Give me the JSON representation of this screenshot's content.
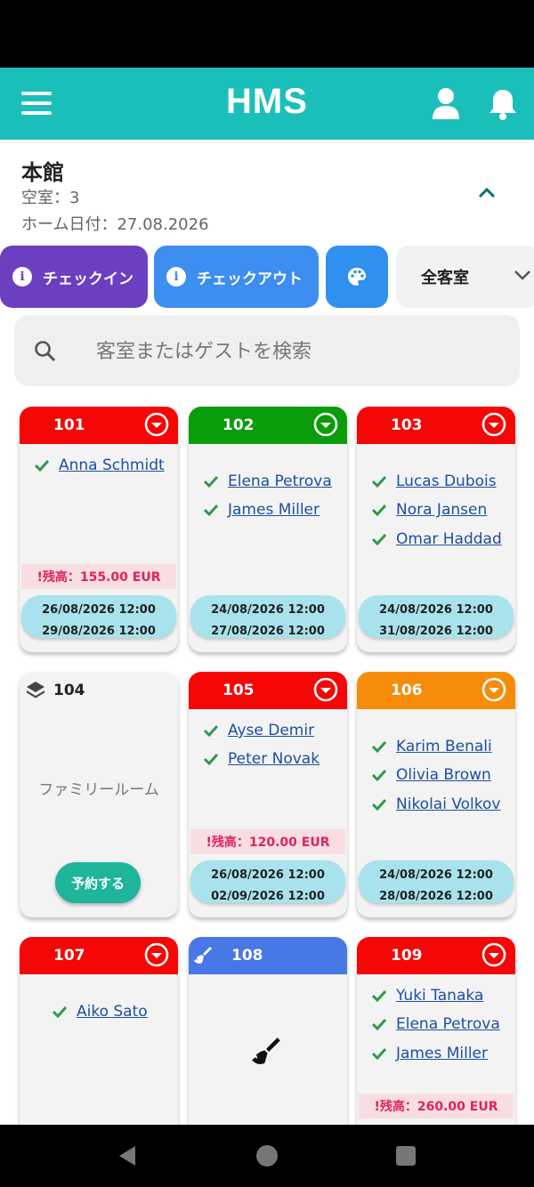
{
  "app": {
    "logo": "HMS"
  },
  "header": {
    "hotel_name": "本館",
    "vacant": "空室：3",
    "home_date": "ホーム日付：27.08.2026"
  },
  "filters": {
    "checkin_label": "チェックイン",
    "checkout_label": "チェックアウト",
    "room_filter_value": "全客室"
  },
  "search": {
    "placeholder": "客室またはゲストを検索"
  },
  "rooms": [
    {
      "number": "101",
      "status_color": "#f60606",
      "guests": [
        "Anna Schmidt"
      ],
      "balance": "!残高：155.00 EUR",
      "checkin": "26/08/2026 12:00",
      "checkout": "29/08/2026 12:00"
    },
    {
      "number": "102",
      "status_color": "#0a9c0a",
      "guests": [
        "Elena Petrova",
        "James Miller"
      ],
      "checkin": "24/08/2026 12:00",
      "checkout": "27/08/2026 12:00"
    },
    {
      "number": "103",
      "status_color": "#f60606",
      "guests": [
        "Lucas Dubois",
        "Nora Jansen",
        "Omar Haddad"
      ],
      "checkin": "24/08/2026 12:00",
      "checkout": "31/08/2026 12:00"
    },
    {
      "number": "104",
      "room_type": "ファミリールーム",
      "book_label": "予約する"
    },
    {
      "number": "105",
      "status_color": "#f60606",
      "guests": [
        "Ayse Demir",
        "Peter Novak"
      ],
      "balance": "!残高：120.00 EUR",
      "checkin": "26/08/2026 12:00",
      "checkout": "02/09/2026 12:00"
    },
    {
      "number": "106",
      "status_color": "#f78c0a",
      "guests": [
        "Karim Benali",
        "Olivia Brown",
        "Nikolai Volkov"
      ],
      "checkin": "24/08/2026 12:00",
      "checkout": "28/08/2026 12:00"
    },
    {
      "number": "107",
      "status_color": "#f60606",
      "guests": [
        "Aiko Sato"
      ]
    },
    {
      "number": "108",
      "status_color": "#4877e6",
      "status_icon": "broom-icon"
    },
    {
      "number": "109",
      "status_color": "#f60606",
      "guests": [
        "Yuki Tanaka",
        "Elena Petrova",
        "James Miller"
      ],
      "balance": "!残高：260.00 EUR"
    }
  ]
}
